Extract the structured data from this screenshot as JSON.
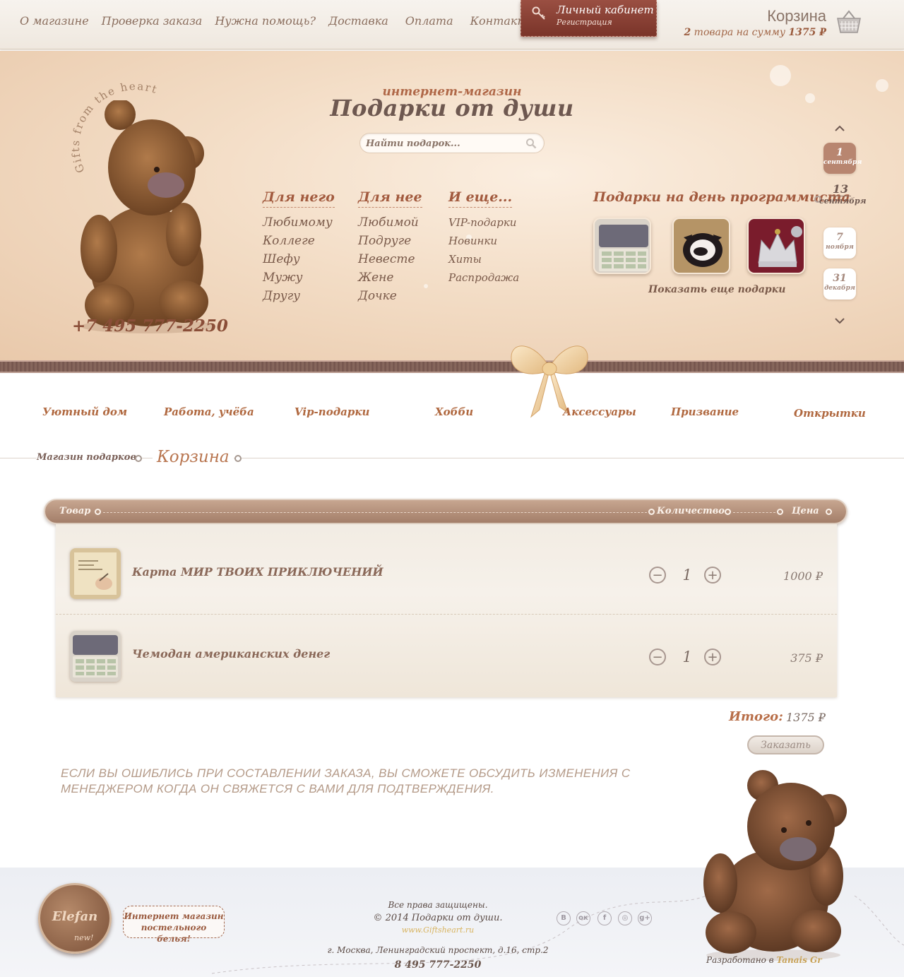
{
  "topnav": {
    "items": [
      "О магазине",
      "Проверка заказа",
      "Нужна помощь?",
      "Доставка",
      "Оплата",
      "Контакты"
    ]
  },
  "cabinet": {
    "title": "Личный кабинет",
    "register": "Регистрация"
  },
  "cart_summary": {
    "title": "Корзина",
    "count": "2",
    "text": "товара на сумму",
    "sum": "1375 ₽"
  },
  "hero": {
    "arc_text": "Gifts from the heart",
    "subtitle": "интернет-магазин",
    "title": "Подарки от души",
    "search_placeholder": "Найти подарок...",
    "phone": "+7 495 777-2250"
  },
  "menus": [
    {
      "head": "Для него",
      "items": [
        "Любимому",
        "Коллеге",
        "Шефу",
        "Мужу",
        "Другу"
      ]
    },
    {
      "head": "Для нее",
      "items": [
        "Любимой",
        "Подруге",
        "Невесте",
        "Жене",
        "Дочке"
      ]
    },
    {
      "head": "И еще...",
      "items": [
        "VIP-подарки",
        "Новинки",
        "Хиты",
        "Распродажа"
      ]
    }
  ],
  "holiday": {
    "title": "Подарки на день программиста",
    "more": "Показать еще подарки"
  },
  "dates": [
    {
      "day": "1",
      "month": "сентября"
    },
    {
      "day": "13",
      "month": "сентября"
    },
    {
      "day": "7",
      "month": "ноября"
    },
    {
      "day": "31",
      "month": "декабря"
    }
  ],
  "categories": [
    "Уютный дом",
    "Работа, учёба",
    "Vip-подарки",
    "Хобби",
    "Аксессуары",
    "Призвание",
    "Открытки"
  ],
  "breadcrumb": {
    "home": "Магазин подарков",
    "current": "Корзина"
  },
  "table": {
    "col_product": "Товар",
    "col_qty": "Количество",
    "col_price": "Цена",
    "rows": [
      {
        "name": "Карта МИР ТВОИХ ПРИКЛЮЧЕНИЙ",
        "qty": "1",
        "price": "1000 ₽"
      },
      {
        "name": "Чемодан американских денег",
        "qty": "1",
        "price": "375 ₽"
      }
    ]
  },
  "total": {
    "label": "Итого:",
    "value": "1375 ₽"
  },
  "order_button": "Заказать",
  "notice": "ЕСЛИ ВЫ ОШИБЛИСЬ ПРИ СОСТАВЛЕНИИ ЗАКАЗА, ВЫ СМОЖЕТЕ ОБСУДИТЬ ИЗМЕНЕНИЯ С МЕНЕДЖЕРОМ КОГДА ОН СВЯЖЕТСЯ С ВАМИ ДЛЯ ПОДТВЕРЖДЕНИЯ.",
  "footer": {
    "elefan_name": "Elefan",
    "elefan_badge": "new!",
    "elefan_bubble": "Интернет магазин постельного белья!",
    "rights": "Все права защищены.",
    "copyright": "© 2014 Подарки от души.",
    "site": "www.Giftsheart.ru",
    "address": "г. Москва, Ленинградский проспект, д.16, стр.2",
    "phone": "8 495 777-2250",
    "social": [
      "В",
      "ок",
      "f",
      "◎",
      "g+"
    ],
    "credits_prefix": "Разработано в",
    "credits_name": "Tanais Gr"
  },
  "colors": {
    "accent": "#b0683f",
    "brown": "#7a3429",
    "text": "#6b4a3a"
  }
}
